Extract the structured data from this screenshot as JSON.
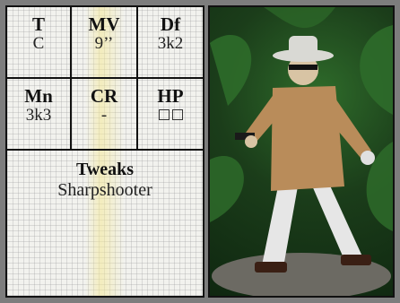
{
  "stats": [
    {
      "label": "T",
      "value": "C"
    },
    {
      "label": "MV",
      "value": "9’’"
    },
    {
      "label": "Df",
      "value": "3k2"
    },
    {
      "label": "Mn",
      "value": "3k3"
    },
    {
      "label": "CR",
      "value": "-"
    },
    {
      "label": "HP",
      "boxes": 2
    }
  ],
  "tweaks": {
    "title": "Tweaks",
    "value": "Sharpshooter"
  },
  "photo": {
    "subject": "painted miniature figure in white hat and mask holding a pistol",
    "background": "jungle foliage",
    "hat_color": "#d9d9d4",
    "coat_color": "#b98c5a",
    "trousers_color": "#e6e6e6",
    "foliage_color": "#2e6b2a"
  }
}
